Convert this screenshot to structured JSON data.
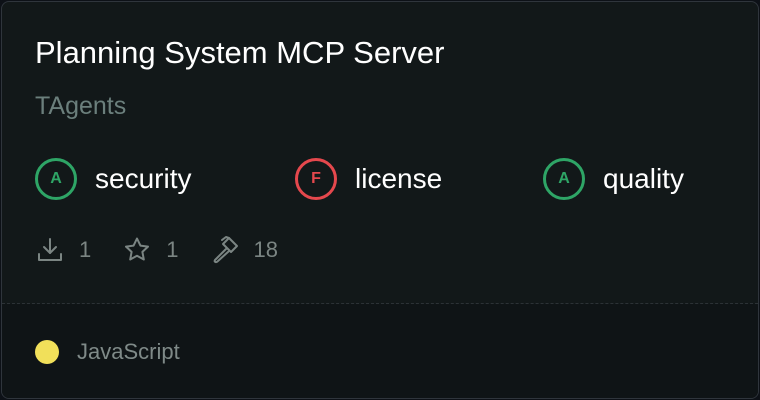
{
  "card": {
    "title": "Planning System MCP Server",
    "owner": "TAgents"
  },
  "grades": [
    {
      "letter": "A",
      "label": "security",
      "color": "#2ea566"
    },
    {
      "letter": "F",
      "label": "license",
      "color": "#e5484d"
    },
    {
      "letter": "A",
      "label": "quality",
      "color": "#2ea566"
    }
  ],
  "stats": {
    "downloads": "1",
    "stars": "1",
    "tools": "18",
    "icons": [
      "download-icon",
      "star-icon",
      "hammer-icon"
    ]
  },
  "language": {
    "name": "JavaScript",
    "color": "#f1e05a"
  },
  "colors": {
    "background": "#121819",
    "footer": "#0f1416",
    "muted": "#7b8583"
  }
}
